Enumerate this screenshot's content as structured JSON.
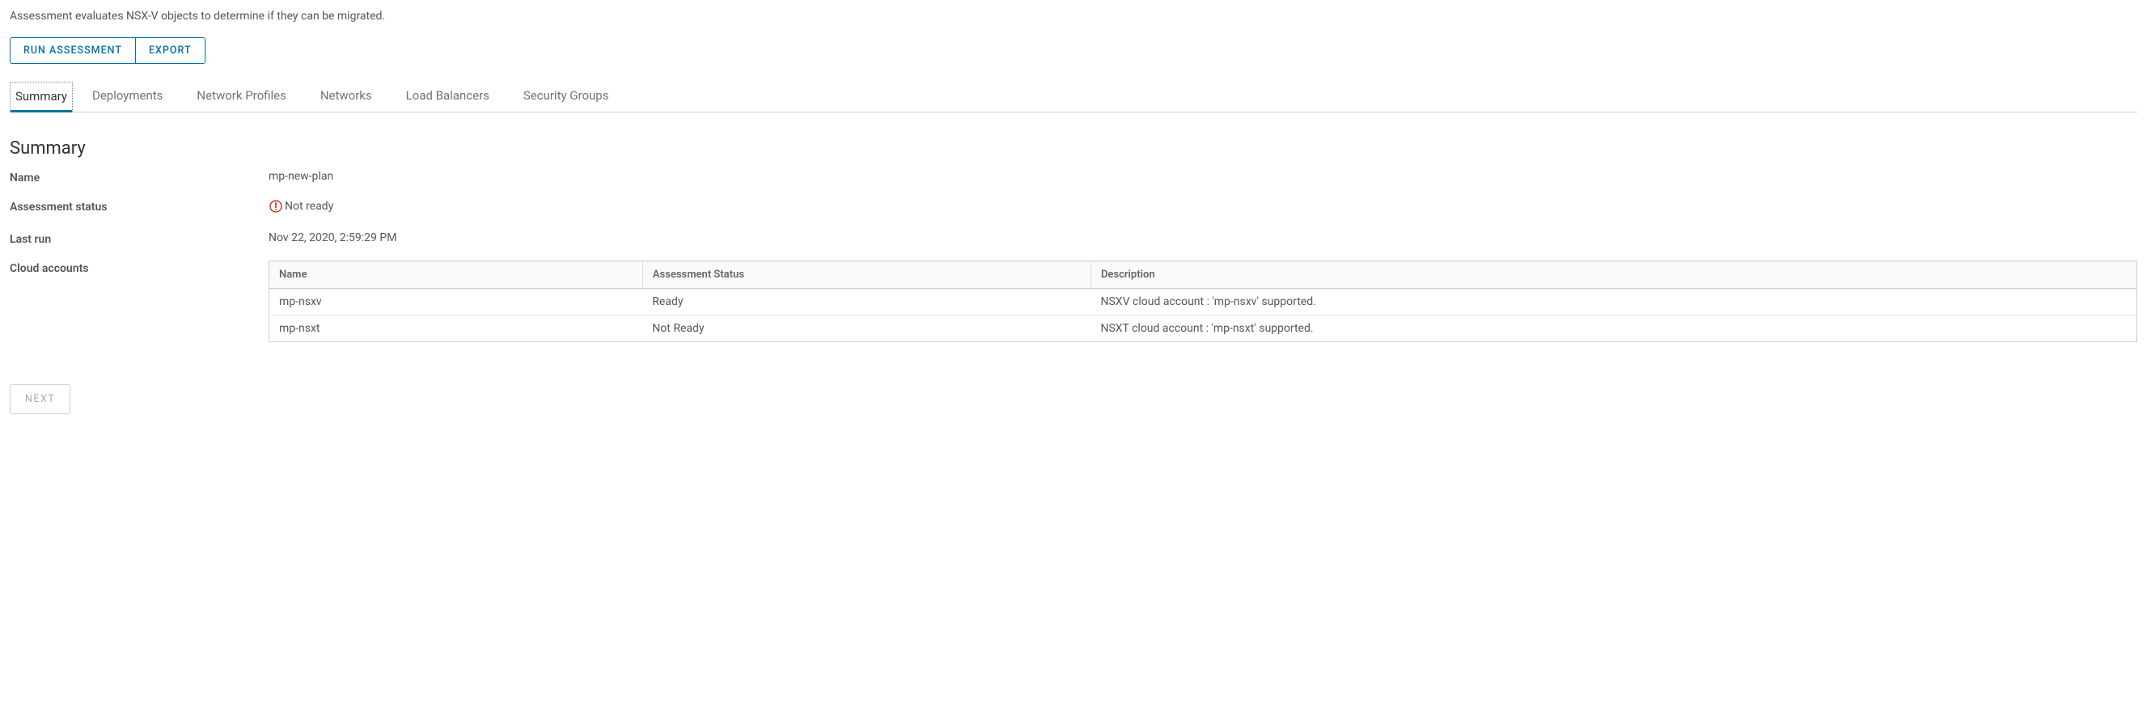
{
  "description": "Assessment evaluates NSX-V objects to determine if they can be migrated.",
  "actions": {
    "run_assessment": "RUN ASSESSMENT",
    "export": "EXPORT"
  },
  "tabs": [
    {
      "label": "Summary",
      "active": true
    },
    {
      "label": "Deployments",
      "active": false
    },
    {
      "label": "Network Profiles",
      "active": false
    },
    {
      "label": "Networks",
      "active": false
    },
    {
      "label": "Load Balancers",
      "active": false
    },
    {
      "label": "Security Groups",
      "active": false
    }
  ],
  "summary": {
    "heading": "Summary",
    "labels": {
      "name": "Name",
      "assessment_status": "Assessment status",
      "last_run": "Last run",
      "cloud_accounts": "Cloud accounts"
    },
    "name": "mp-new-plan",
    "assessment_status": "Not ready",
    "last_run": "Nov 22, 2020, 2:59:29 PM",
    "cloud_table": {
      "headers": {
        "name": "Name",
        "status": "Assessment Status",
        "description": "Description"
      },
      "rows": [
        {
          "name": "mp-nsxv",
          "status": "Ready",
          "description": "NSXV cloud account : 'mp-nsxv' supported."
        },
        {
          "name": "mp-nsxt",
          "status": "Not Ready",
          "description": "NSXT cloud account : 'mp-nsxt' supported."
        }
      ]
    }
  },
  "footer": {
    "next": "NEXT"
  }
}
